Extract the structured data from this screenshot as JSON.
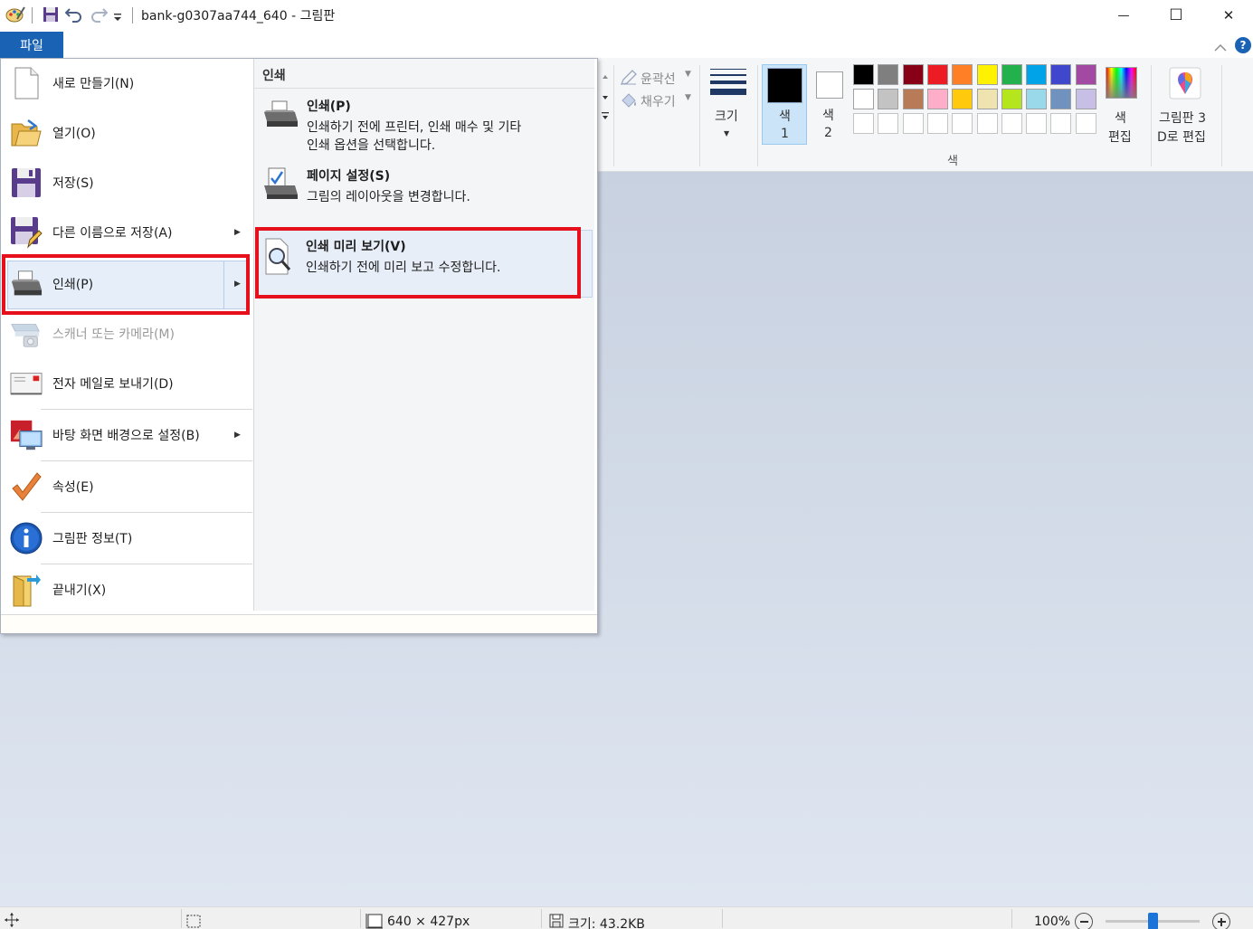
{
  "window": {
    "title": "bank-g0307aa744_640 - 그림판",
    "minimize_glyph": "—",
    "maximize_glyph": "☐",
    "close_glyph": "✕"
  },
  "ribbon": {
    "file_tab": "파일",
    "help_label": "?",
    "outline_label": "윤곽선",
    "fill_label": "채우기",
    "size_label": "크기",
    "color1_label": "색",
    "color1_num": "1",
    "color2_label": "색",
    "color2_num": "2",
    "edit_colors_label_1": "색",
    "edit_colors_label_2": "편집",
    "paint3d_label_1": "그림판 3",
    "paint3d_label_2": "D로 편집",
    "colors_group_label": "색",
    "palette_row1": [
      "#000000",
      "#7f7f7f",
      "#880015",
      "#ed1c24",
      "#ff7f27",
      "#fff200",
      "#22b14c",
      "#00a2e8",
      "#3f48cc",
      "#a349a4"
    ],
    "palette_row2": [
      "#ffffff",
      "#c3c3c3",
      "#b97a57",
      "#ffaec9",
      "#ffc90e",
      "#efe4b0",
      "#b5e61d",
      "#99d9ea",
      "#7092be",
      "#c8bfe7"
    ]
  },
  "file_menu": {
    "items": [
      {
        "label": "새로 만들기(N)"
      },
      {
        "label": "열기(O)"
      },
      {
        "label": "저장(S)"
      },
      {
        "label": "다른 이름으로 저장(A)"
      },
      {
        "label": "인쇄(P)"
      },
      {
        "label": "스캐너 또는 카메라(M)"
      },
      {
        "label": "전자 메일로 보내기(D)"
      },
      {
        "label": "바탕 화면 배경으로 설정(B)"
      },
      {
        "label": "속성(E)"
      },
      {
        "label": "그림판 정보(T)"
      },
      {
        "label": "끝내기(X)"
      }
    ],
    "submenu": {
      "header": "인쇄",
      "items": [
        {
          "title": "인쇄(P)",
          "desc_1": "인쇄하기 전에 프린터, 인쇄 매수 및 기타",
          "desc_2": "인쇄 옵션을 선택합니다."
        },
        {
          "title": "페이지 설정(S)",
          "desc_1": "그림의 레이아웃을 변경합니다.",
          "desc_2": ""
        },
        {
          "title": "인쇄 미리 보기(V)",
          "desc_1": "인쇄하기 전에 미리 보고 수정합니다.",
          "desc_2": ""
        }
      ]
    }
  },
  "statusbar": {
    "dimensions": "640 × 427px",
    "size": "크기: 43.2KB",
    "zoom": "100%",
    "zoom_slider_fraction": 0.5
  }
}
